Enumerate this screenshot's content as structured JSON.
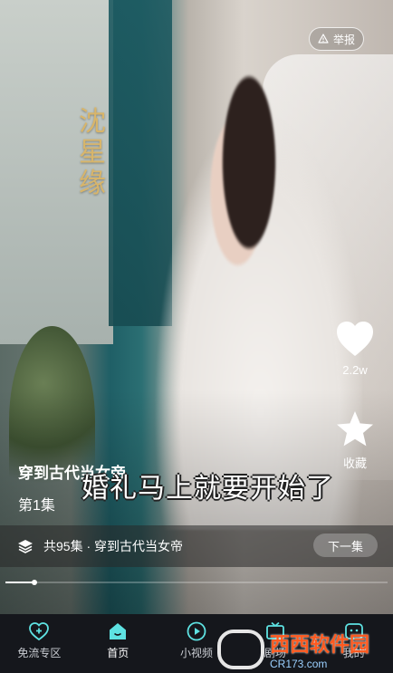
{
  "app": {
    "accent": "#5ee2e2",
    "show_logo_text": "沈星缘",
    "report_label": "举报",
    "like_count": "2.2w",
    "favorite_label": "收藏",
    "drama_title": "穿到古代当女帝",
    "episode_label": "第1集",
    "subtitle_text": "婚礼马上就要开始了",
    "series_summary": "共95集 · 穿到古代当女帝",
    "next_button_label": "下一集",
    "progress_fraction": 0.075
  },
  "tabs": [
    {
      "label": "免流专区",
      "icon": "plus-heart-icon",
      "active": false
    },
    {
      "label": "首页",
      "icon": "home-icon",
      "active": true
    },
    {
      "label": "小视频",
      "icon": "play-circle-icon",
      "active": false
    },
    {
      "label": "剧场",
      "icon": "tv-icon",
      "active": false
    },
    {
      "label": "我的",
      "icon": "profile-icon",
      "active": false
    }
  ],
  "watermark": {
    "text": "西西软件园",
    "sub": "CR173.com"
  }
}
